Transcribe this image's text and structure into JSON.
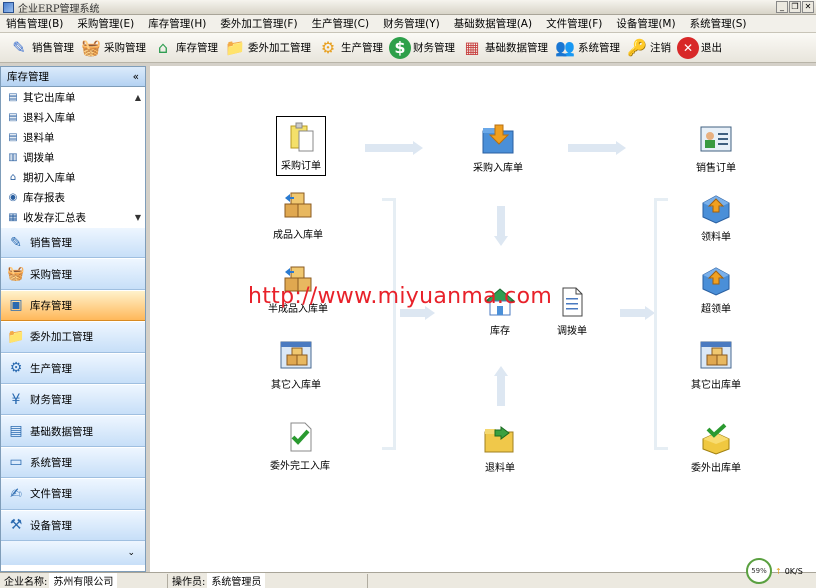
{
  "window": {
    "title": "企业ERP管理系统",
    "controls": [
      "_",
      "❐",
      "✕"
    ]
  },
  "menu": [
    "销售管理(B)",
    "采购管理(E)",
    "库存管理(H)",
    "委外加工管理(F)",
    "生产管理(C)",
    "财务管理(Y)",
    "基础数据管理(A)",
    "文件管理(F)",
    "设备管理(M)",
    "系统管理(S)"
  ],
  "toolbar": [
    {
      "label": "销售管理",
      "icon": "pencil-icon",
      "color": "#3a6fd0"
    },
    {
      "label": "采购管理",
      "icon": "basket-icon",
      "color": "#2f7fd8"
    },
    {
      "label": "库存管理",
      "icon": "house-icon",
      "color": "#2f9e52"
    },
    {
      "label": "委外加工管理",
      "icon": "folder-icon",
      "color": "#e0b43a"
    },
    {
      "label": "生产管理",
      "icon": "gear-icon",
      "color": "#e8a020"
    },
    {
      "label": "财务管理",
      "icon": "dollar-icon",
      "color": "#2ea04a"
    },
    {
      "label": "基础数据管理",
      "icon": "calendar-icon",
      "color": "#c84040"
    },
    {
      "label": "系统管理",
      "icon": "people-icon",
      "color": "#d89030"
    },
    {
      "label": "注销",
      "icon": "key-icon",
      "color": "#d8a030"
    },
    {
      "label": "退出",
      "icon": "exit-icon",
      "color": "#d82828"
    }
  ],
  "sidebar": {
    "header": "库存管理",
    "collapse_glyph": "«",
    "items": [
      {
        "label": "其它出库单",
        "icon": "doc-out-icon"
      },
      {
        "label": "退料入库单",
        "icon": "doc-in-icon"
      },
      {
        "label": "退料单",
        "icon": "doc-icon"
      },
      {
        "label": "调拨单",
        "icon": "transfer-icon"
      },
      {
        "label": "期初入库单",
        "icon": "house-icon"
      },
      {
        "label": "库存报表",
        "icon": "report-icon"
      },
      {
        "label": "收发存汇总表",
        "icon": "summary-icon"
      }
    ],
    "nav": [
      {
        "label": "销售管理",
        "icon": "pencil-icon",
        "active": false
      },
      {
        "label": "采购管理",
        "icon": "basket-icon",
        "active": false
      },
      {
        "label": "库存管理",
        "icon": "warehouse-icon",
        "active": true
      },
      {
        "label": "委外加工管理",
        "icon": "folder-icon",
        "active": false
      },
      {
        "label": "生产管理",
        "icon": "gear-icon",
        "active": false
      },
      {
        "label": "财务管理",
        "icon": "money-icon",
        "active": false
      },
      {
        "label": "基础数据管理",
        "icon": "book-icon",
        "active": false
      },
      {
        "label": "系统管理",
        "icon": "system-icon",
        "active": false
      },
      {
        "label": "文件管理",
        "icon": "file-icon",
        "active": false
      },
      {
        "label": "设备管理",
        "icon": "equipment-icon",
        "active": false
      }
    ],
    "footer_glyph": "⌄"
  },
  "flow": {
    "purchase_order": "采购订单",
    "purchase_in": "采购入库单",
    "sales_order": "销售订单",
    "finished_in": "成品入库单",
    "semi_in": "半成品入库单",
    "other_in": "其它入库单",
    "outsource_in": "委外完工入库",
    "inventory": "库存",
    "transfer": "调拨单",
    "return_material": "退料单",
    "requisition": "领料单",
    "over_requisition": "超领单",
    "other_out": "其它出库单",
    "outsource_out": "委外出库单"
  },
  "watermark": "http://www.miyuanma.com",
  "status": {
    "company_label": "企业名称:",
    "company_value": "苏州有限公司",
    "operator_label": "操作员:",
    "operator_value": "系统管理员",
    "net_percent": "59%",
    "net_speed": "0K/S"
  }
}
